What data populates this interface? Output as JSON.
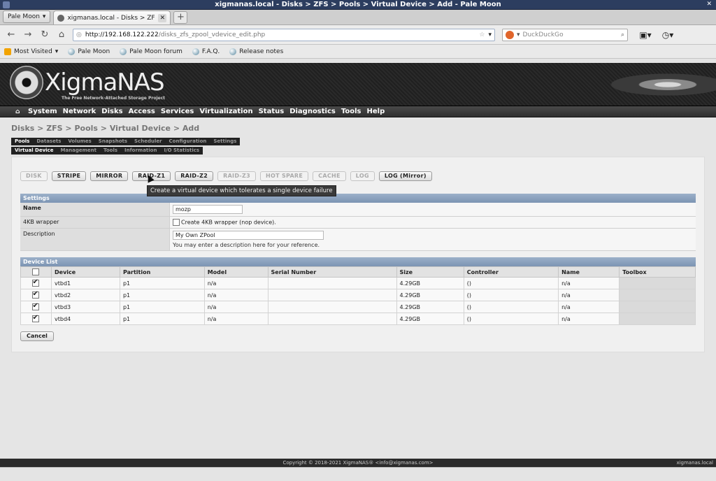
{
  "window": {
    "title": "xigmanas.local - Disks > ZFS > Pools > Virtual Device > Add - Pale Moon"
  },
  "tabbar": {
    "app_button": "Pale Moon",
    "tab_label": "xigmanas.local - Disks > ZFS ...",
    "new_tab": "+"
  },
  "navbar": {
    "url_host": "http://192.168.122.222",
    "url_path": "/disks_zfs_zpool_vdevice_edit.php",
    "search_placeholder": "DuckDuckGo"
  },
  "bookmarks": [
    "Most Visited",
    "Pale Moon",
    "Pale Moon forum",
    "F.A.Q.",
    "Release notes"
  ],
  "banner": {
    "logo_left": "Xigma",
    "logo_right": "NAS",
    "tagline": "The Free Network-Attached Storage Project"
  },
  "menu": [
    "System",
    "Network",
    "Disks",
    "Access",
    "Services",
    "Virtualization",
    "Status",
    "Diagnostics",
    "Tools",
    "Help"
  ],
  "breadcrumb": "Disks > ZFS > Pools > Virtual Device > Add",
  "subtabs1": [
    "Pools",
    "Datasets",
    "Volumes",
    "Snapshots",
    "Scheduler",
    "Configuration",
    "Settings"
  ],
  "subtabs2": [
    "Virtual Device",
    "Management",
    "Tools",
    "Information",
    "I/O Statistics"
  ],
  "vdev_buttons": [
    "DISK",
    "STRIPE",
    "MIRROR",
    "RAID-Z1",
    "RAID-Z2",
    "RAID-Z3",
    "HOT SPARE",
    "CACHE",
    "LOG",
    "LOG (Mirror)"
  ],
  "tooltip": "Create a virtual device which tolerates a single device failure",
  "settings": {
    "header": "Settings",
    "name_label": "Name",
    "name_value": "mozp",
    "wrapper_label": "4KB wrapper",
    "wrapper_text": "Create 4KB wrapper (nop device).",
    "desc_label": "Description",
    "desc_value": "My Own ZPool",
    "desc_hint": "You may enter a description here for your reference."
  },
  "device_list": {
    "header": "Device List",
    "columns": [
      "Device",
      "Partition",
      "Model",
      "Serial Number",
      "Size",
      "Controller",
      "Name",
      "Toolbox"
    ],
    "rows": [
      {
        "device": "vtbd1",
        "partition": "p1",
        "model": "n/a",
        "serial": "",
        "size": "4.29GB",
        "controller": "()",
        "name": "n/a"
      },
      {
        "device": "vtbd2",
        "partition": "p1",
        "model": "n/a",
        "serial": "",
        "size": "4.29GB",
        "controller": "()",
        "name": "n/a"
      },
      {
        "device": "vtbd3",
        "partition": "p1",
        "model": "n/a",
        "serial": "",
        "size": "4.29GB",
        "controller": "()",
        "name": "n/a"
      },
      {
        "device": "vtbd4",
        "partition": "p1",
        "model": "n/a",
        "serial": "",
        "size": "4.29GB",
        "controller": "()",
        "name": "n/a"
      }
    ]
  },
  "cancel_label": "Cancel",
  "footer": {
    "copyright": "Copyright © 2018-2021 XigmaNAS® <info@xigmanas.com>",
    "host": "xigmanas.local"
  }
}
